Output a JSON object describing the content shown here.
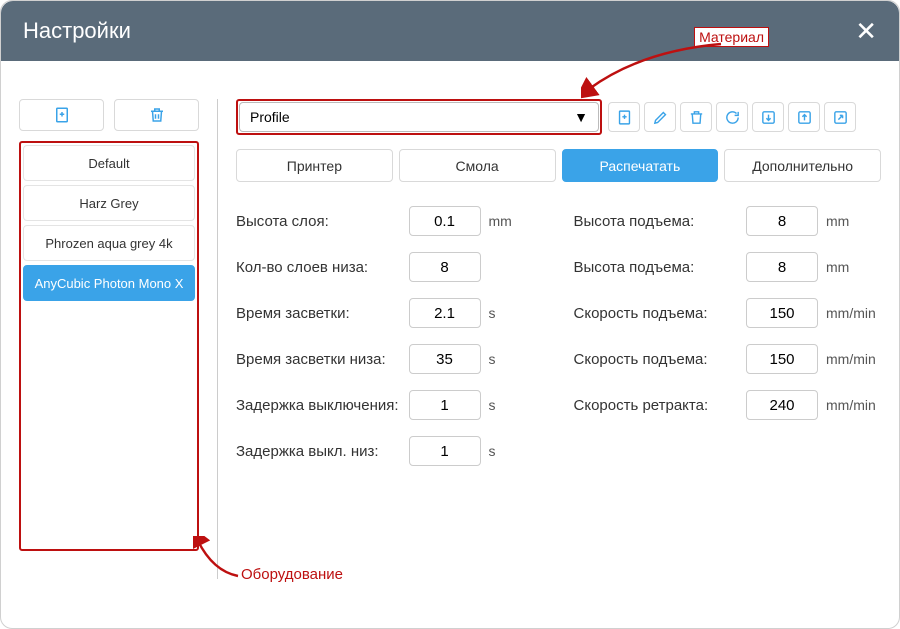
{
  "header": {
    "title": "Настройки"
  },
  "annotations": {
    "material": "Материал",
    "equipment": "Оборудование"
  },
  "sidebar": {
    "items": [
      {
        "label": "Default"
      },
      {
        "label": "Harz Grey"
      },
      {
        "label": "Phrozen aqua grey 4k"
      },
      {
        "label": "AnyCubic Photon Mono X"
      }
    ]
  },
  "profile": {
    "label": "Profile"
  },
  "tabs": {
    "printer": "Принтер",
    "resin": "Смола",
    "print": "Распечатать",
    "extra": "Дополнительно"
  },
  "settings_left": [
    {
      "label": "Высота слоя:",
      "value": "0.1",
      "unit": "mm"
    },
    {
      "label": "Кол-во слоев низа:",
      "value": "8",
      "unit": ""
    },
    {
      "label": "Время засветки:",
      "value": "2.1",
      "unit": "s"
    },
    {
      "label": "Время засветки низа:",
      "value": "35",
      "unit": "s"
    },
    {
      "label": "Задержка выключения:",
      "value": "1",
      "unit": "s"
    },
    {
      "label": "Задержка выкл. низ:",
      "value": "1",
      "unit": "s"
    }
  ],
  "settings_right": [
    {
      "label": "Высота подъема:",
      "value": "8",
      "unit": "mm"
    },
    {
      "label": "Высота подъема:",
      "value": "8",
      "unit": "mm"
    },
    {
      "label": "Скорость подъема:",
      "value": "150",
      "unit": "mm/min"
    },
    {
      "label": "Скорость подъема:",
      "value": "150",
      "unit": "mm/min"
    },
    {
      "label": "Скорость ретракта:",
      "value": "240",
      "unit": "mm/min"
    }
  ]
}
